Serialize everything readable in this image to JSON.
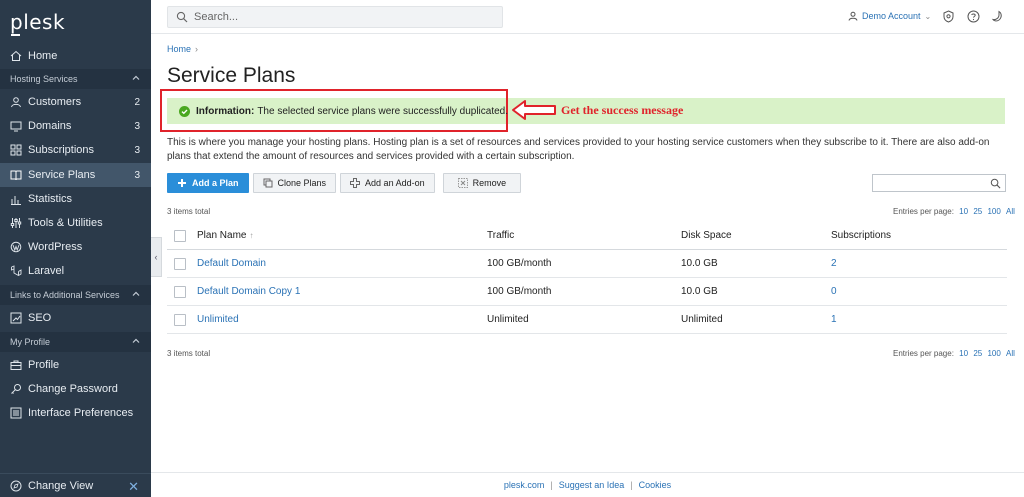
{
  "brand": {
    "logo_text": "plesk"
  },
  "sidebar": {
    "home": "Home",
    "section_hosting": "Hosting Services",
    "items_hosting": [
      {
        "label": "Customers",
        "badge": "2"
      },
      {
        "label": "Domains",
        "badge": "3"
      },
      {
        "label": "Subscriptions",
        "badge": "3"
      },
      {
        "label": "Service Plans",
        "badge": "3"
      },
      {
        "label": "Statistics",
        "badge": ""
      },
      {
        "label": "Tools & Utilities",
        "badge": ""
      },
      {
        "label": "WordPress",
        "badge": ""
      },
      {
        "label": "Laravel",
        "badge": ""
      }
    ],
    "section_links": "Links to Additional Services",
    "seo": "SEO",
    "section_profile": "My Profile",
    "profile": "Profile",
    "change_password": "Change Password",
    "interface_preferences": "Interface Preferences",
    "change_view": "Change View",
    "active_item": "Service Plans"
  },
  "header": {
    "search_placeholder": "Search...",
    "account": "Demo Account"
  },
  "breadcrumb": {
    "home": "Home"
  },
  "page": {
    "title": "Service Plans",
    "message_label": "Information:",
    "message_text": "The selected service plans were successfully duplicated.",
    "annotation": "Get the success message",
    "description": "This is where you manage your hosting plans. Hosting plan is a set of resources and services provided to your hosting service customers when they subscribe to it. There are also add-on plans that extend the amount of resources and services provided with a certain subscription."
  },
  "toolbar": {
    "add_plan": "Add a Plan",
    "clone_plans": "Clone Plans",
    "add_addon": "Add an Add-on",
    "remove": "Remove"
  },
  "list": {
    "total_top": "3 items total",
    "total_bottom": "3 items total",
    "entries_label": "Entries per page:",
    "page_sizes": [
      "10",
      "25",
      "100",
      "All"
    ],
    "columns": [
      "Plan Name",
      "Traffic",
      "Disk Space",
      "Subscriptions"
    ],
    "sort_glyph": "↑",
    "rows": [
      {
        "name": "Default Domain",
        "traffic": "100 GB/month",
        "disk": "10.0 GB",
        "subs": "2"
      },
      {
        "name": "Default Domain Copy 1",
        "traffic": "100 GB/month",
        "disk": "10.0 GB",
        "subs": "0"
      },
      {
        "name": "Unlimited",
        "traffic": "Unlimited",
        "disk": "Unlimited",
        "subs": "1"
      }
    ]
  },
  "footer": {
    "links": [
      "plesk.com",
      "Suggest an Idea",
      "Cookies"
    ]
  },
  "colors": {
    "sidebar_bg": "#2b3a4a",
    "accent": "#2a8ed9",
    "success_bg": "#d9f2c8",
    "annotation_red": "#e0232b"
  }
}
